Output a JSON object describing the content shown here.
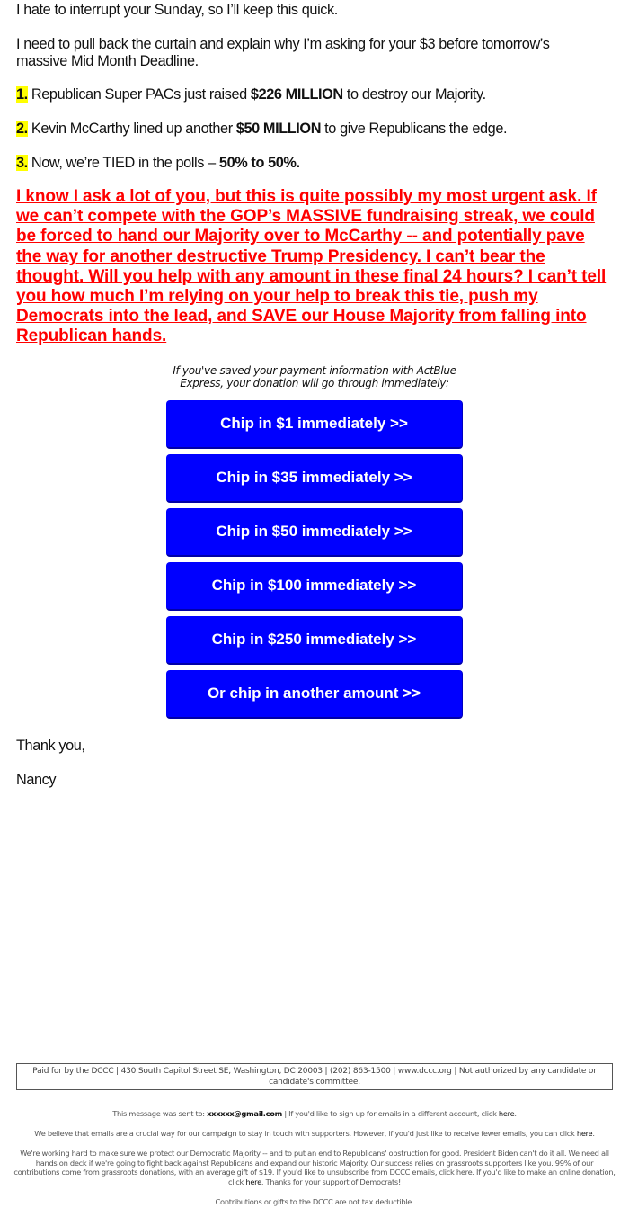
{
  "email": {
    "greeting_line": "I hate to interrupt your Sunday, so I’ll keep this quick.",
    "intro_line": "I need to pull back the curtain and explain why I’m asking for your $3 before tomorrow’s massive Mid Month Deadline.",
    "points": [
      {
        "num": "1.",
        "pre": " Republican Super PACs just raised ",
        "bold": "$226 MILLION",
        "post": " to destroy our Majority."
      },
      {
        "num": "2.",
        "pre": " Kevin McCarthy lined up another ",
        "bold": "$50 MILLION",
        "post": " to give Republicans the edge."
      },
      {
        "num": "3.",
        "pre": " Now, we’re TIED in the polls – ",
        "bold": "50% to 50%.",
        "post": ""
      }
    ],
    "urgent_paragraph": "I know I ask a lot of you, but this is quite possibly my most urgent ask. If we can’t compete with the GOP’s MASSIVE fundraising streak, we could be forced to hand our Majority over to McCarthy -- and potentially pave the way for another destructive Trump Presidency. I can’t bear the thought. Will you help with any amount in these final 24 hours? I can’t tell you how much I’m relying on your help to break this tie, push my Democrats into the lead, and SAVE our House Majority from falling into Republican hands.",
    "express_note_line1": "If you've saved your payment information with ActBlue",
    "express_note_line2": "Express, your donation will go through immediately:",
    "buttons": [
      {
        "label": "Chip in $1 immediately >>"
      },
      {
        "label": "Chip in $35 immediately >>"
      },
      {
        "label": "Chip in $50 immediately >>"
      },
      {
        "label": "Chip in $100 immediately >>"
      },
      {
        "label": "Chip in $250 immediately >>"
      },
      {
        "label": "Or chip in another amount >>"
      }
    ],
    "closing": "Thank you,",
    "signature": "Nancy"
  },
  "footer": {
    "paid_for": "Paid for by the DCCC | 430 South Capitol Street SE, Washington, DC 20003 | (202) 863-1500 | www.dccc.org | Not authorized by any candidate or candidate's committee.",
    "sent_to_prefix": "This message was sent to: ",
    "sent_to_email": "xxxxxx@gmail.com",
    "sent_to_suffix": " | If you'd like to sign up for emails in a different account, click ",
    "here": "here",
    "fewer_emails": "We believe that emails are a crucial way for our campaign to stay in touch with supporters. However, if you'd just like to receive fewer emails, you can click ",
    "working_hard": "We're working hard to make sure we protect our Democratic Majority -- and to put an end to Republicans' obstruction for good. President Biden can't do it all. We need all hands on deck if we're going to fight back against Republicans and expand our historic Majority. Our success relies on grassroots supporters like you. 99% of our contributions come from grassroots donations, with an average gift of $19. If you'd like to unsubscribe from DCCC emails, click here. If you'd like to make an online donation, click ",
    "thanks": ". Thanks for your support of Democrats!",
    "tax_note": "Contributions or gifts to the DCCC are not tax deductible."
  },
  "colors": {
    "button_bg": "#0000ff",
    "urgent_text": "#ff0000",
    "highlight": "#ffff00"
  }
}
